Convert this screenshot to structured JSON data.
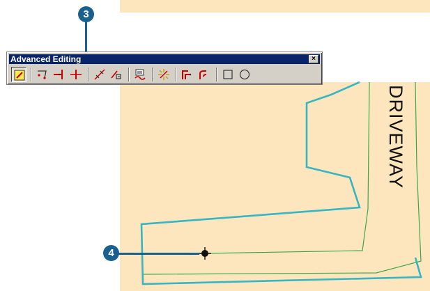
{
  "toolbar": {
    "title": "Advanced Editing",
    "close_label": "×",
    "tools": [
      "extend-trim-icon",
      "fillet-icon",
      "extend-icon",
      "trim-icon",
      "line-intersection-icon",
      "align-edge-icon",
      "copy-parallel-icon",
      "explode-icon",
      "generalize-icon",
      "smooth-icon",
      "rectangle-icon",
      "circle-icon"
    ]
  },
  "map": {
    "label": "DRIVEWAY",
    "background": "#fde6bd",
    "parcel_color": "#36b5c2",
    "line_color": "#3aa84a"
  },
  "callouts": [
    {
      "number": "3"
    },
    {
      "number": "4"
    }
  ],
  "colors": {
    "callout": "#19608f"
  }
}
